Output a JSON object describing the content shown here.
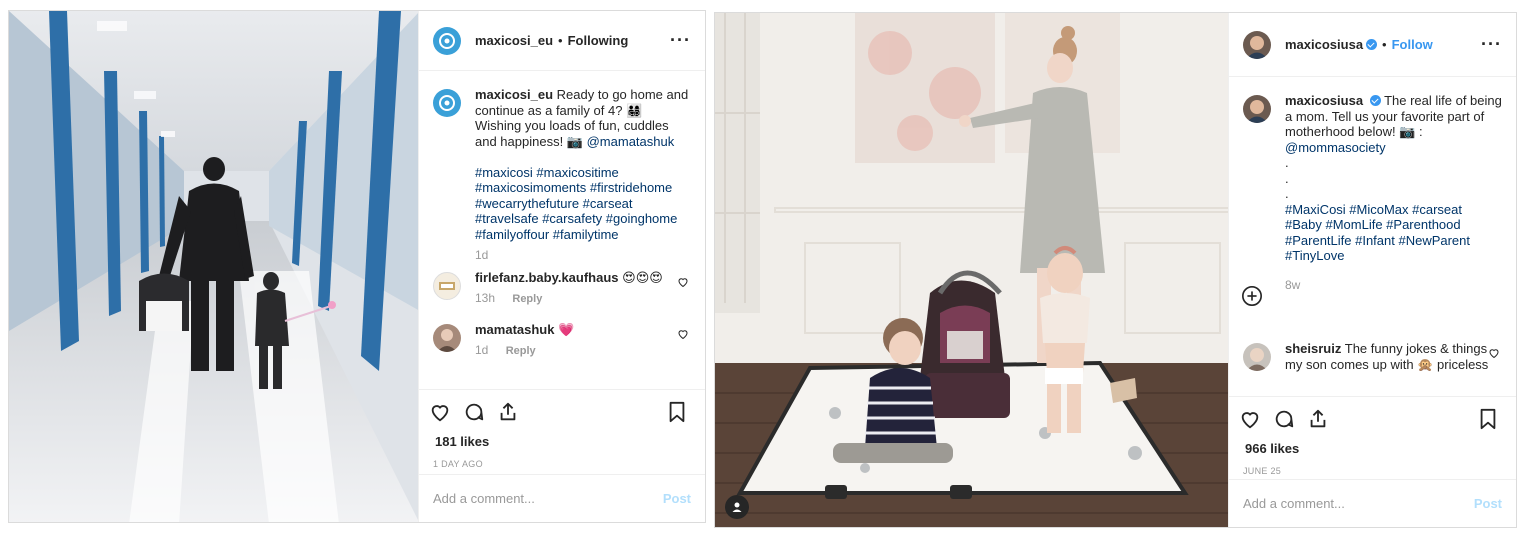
{
  "post1": {
    "username": "maxicosi_eu",
    "follow_state": "Following",
    "dot": "•",
    "caption": {
      "username": "maxicosi_eu",
      "text": "Ready to go home and continue as a family of 4? 👨‍👩‍👧‍👦 Wishing you loads of fun, cuddles and happiness! 📷",
      "mention": "@mamatashuk",
      "hashtags": "#maxicosi #maxicositime #maxicosimoments #firstridehome #wecarrythefuture #carseat #travelsafe #carsafety #goinghome #familyoffour #familytime",
      "time": "1d"
    },
    "comments": [
      {
        "username": "firlefanz.baby.kaufhaus",
        "text": "😍😍😍",
        "time": "13h",
        "reply": "Reply"
      },
      {
        "username": "mamatashuk",
        "text": "💗",
        "time": "1d",
        "reply": "Reply"
      }
    ],
    "likes": "181 likes",
    "ago": "1 DAY AGO",
    "comment_placeholder": "Add a comment...",
    "post_label": "Post",
    "colors": {
      "brand": "#3aa0d8",
      "link": "#003569",
      "post_disabled": "#b2dffc"
    }
  },
  "post2": {
    "username": "maxicosiusa",
    "follow_label": "Follow",
    "dot": "•",
    "caption": {
      "username": "maxicosiusa",
      "text": "The real life of being a mom. Tell us your favorite part of motherhood below! 📷 :",
      "mention": "@mommasociety",
      "dots": [
        ".",
        ".",
        "."
      ],
      "hashtags": "#MaxiCosi #MicoMax #carseat #Baby #MomLife #Parenthood #ParentLife #Infant #NewParent #TinyLove",
      "time": "8w"
    },
    "comments": [
      {
        "username": "sheisruiz",
        "text": "The funny jokes & things my son comes up with 🙊 priceless"
      }
    ],
    "likes": "966 likes",
    "ago": "JUNE 25",
    "comment_placeholder": "Add a comment...",
    "post_label": "Post",
    "colors": {
      "follow": "#3897f0",
      "verified": "#3897f0"
    }
  }
}
